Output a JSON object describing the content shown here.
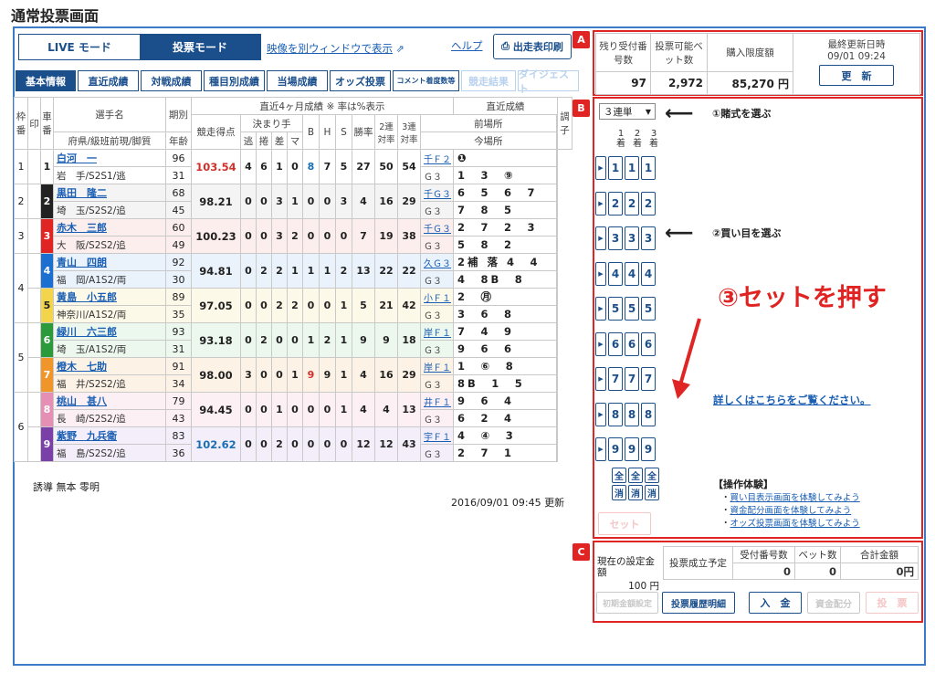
{
  "page_title": "通常投票画面",
  "mode": {
    "live": "LIVE モード",
    "vote": "投票モード"
  },
  "top_links": {
    "video": "映像を別ウィンドウで表示",
    "help": "ヘルプ",
    "print": "出走表印刷"
  },
  "tabs": [
    {
      "label": "基本情報",
      "state": "active"
    },
    {
      "label": "直近成績",
      "state": "normal"
    },
    {
      "label": "対戦成績",
      "state": "normal"
    },
    {
      "label": "種目別成績",
      "state": "normal"
    },
    {
      "label": "当場成績",
      "state": "normal"
    },
    {
      "label": "オッズ投票",
      "state": "normal"
    },
    {
      "label": "コメント着度数等",
      "state": "normal"
    },
    {
      "label": "競走結果",
      "state": "disabled"
    },
    {
      "label": "ダイジェスト",
      "state": "disabled"
    }
  ],
  "table_header": {
    "waku": "枠番",
    "shirushi": "印",
    "sha": "車番",
    "name": "選手名",
    "pref": "府県/級班前現/脚質",
    "kibetsu": "期別",
    "age": "年齢",
    "recent": "直近4ヶ月成績 ※ 率は%表示",
    "points": "競走得点",
    "kimarite": "決まり手",
    "k1": "逃",
    "k2": "捲",
    "k3": "差",
    "k4": "マ",
    "bb": "B",
    "hh": "H",
    "ss": "S",
    "win": "勝率",
    "ren2": "2連対率",
    "ren3": "3連対率",
    "results": "直近成績",
    "zen": "前場所",
    "kon": "今場所",
    "cho": "調子"
  },
  "riders": [
    {
      "waku": "1",
      "sha": "1",
      "name": "白河　一",
      "pref": "岩　手/S2S1/逃",
      "ki": "96",
      "age": "31",
      "pt": "103.54",
      "k": [
        "4",
        "6",
        "1",
        "0"
      ],
      "b": "8",
      "h": "7",
      "s": "5",
      "win": "27",
      "r2": "50",
      "r3": "54",
      "zen": "千Ｆ２",
      "zenr": "❶",
      "kon": "Ｇ３",
      "konr": "1　3　⑨",
      "color": "#ffffff",
      "tcolor": "#222",
      "bg": "#ffffff"
    },
    {
      "waku": "2",
      "sha": "2",
      "name": "黒田　隆二",
      "pref": "埼　玉/S2S2/追",
      "ki": "68",
      "age": "45",
      "pt": "98.21",
      "k": [
        "0",
        "0",
        "3",
        "1"
      ],
      "b": "0",
      "h": "0",
      "s": "3",
      "win": "4",
      "r2": "16",
      "r3": "29",
      "zen": "千Ｇ３",
      "zenr": "6　5　6　7",
      "kon": "Ｇ３",
      "konr": "7　8　5",
      "color": "#222",
      "tcolor": "#fff",
      "bg": "#f4f4f4"
    },
    {
      "waku": "3",
      "sha": "3",
      "name": "赤木　三郎",
      "pref": "大　阪/S2S2/追",
      "ki": "60",
      "age": "49",
      "pt": "100.23",
      "k": [
        "0",
        "0",
        "3",
        "2"
      ],
      "b": "0",
      "h": "0",
      "s": "0",
      "win": "7",
      "r2": "19",
      "r3": "38",
      "zen": "千Ｇ３",
      "zenr": "2　7　2　3",
      "kon": "Ｇ３",
      "konr": "5　8　2",
      "color": "#e02424",
      "tcolor": "#fff",
      "bg": "#fdeeee"
    },
    {
      "waku": "4",
      "sha": "4",
      "name": "青山　四朗",
      "pref": "福　岡/A1S2/両",
      "ki": "92",
      "age": "30",
      "pt": "94.81",
      "k": [
        "0",
        "2",
        "2",
        "1"
      ],
      "b": "1",
      "h": "1",
      "s": "2",
      "win": "13",
      "r2": "22",
      "r3": "22",
      "zen": "久Ｇ３",
      "zenr": "2補 落 4　4",
      "kon": "Ｇ３",
      "konr": "4　8B　8",
      "color": "#1a6fd0",
      "tcolor": "#fff",
      "bg": "#eaf2fc"
    },
    {
      "waku": "4",
      "sha": "5",
      "name": "黄島　小五郎",
      "pref": "神奈川/A1S2/両",
      "ki": "89",
      "age": "35",
      "pt": "97.05",
      "k": [
        "0",
        "0",
        "2",
        "2"
      ],
      "b": "0",
      "h": "0",
      "s": "1",
      "win": "5",
      "r2": "21",
      "r3": "42",
      "zen": "小Ｆ１",
      "zenr": "2　㊊",
      "kon": "Ｇ３",
      "konr": "3　6　8",
      "color": "#f2d54a",
      "tcolor": "#222",
      "bg": "#fdf9e8"
    },
    {
      "waku": "5",
      "sha": "6",
      "name": "緑川　六三郎",
      "pref": "埼　玉/A1S2/両",
      "ki": "93",
      "age": "31",
      "pt": "93.18",
      "k": [
        "0",
        "2",
        "0",
        "0"
      ],
      "b": "1",
      "h": "2",
      "s": "1",
      "win": "9",
      "r2": "9",
      "r3": "18",
      "zen": "岸Ｆ１",
      "zenr": "7　4　9",
      "kon": "Ｇ３",
      "konr": "9　6　6",
      "color": "#2a9a3a",
      "tcolor": "#fff",
      "bg": "#ecf7ee"
    },
    {
      "waku": "5",
      "sha": "7",
      "name": "橙木　七助",
      "pref": "福　井/S2S2/追",
      "ki": "91",
      "age": "34",
      "pt": "98.00",
      "k": [
        "3",
        "0",
        "0",
        "1"
      ],
      "b": "9",
      "h": "9",
      "s": "1",
      "win": "4",
      "r2": "16",
      "r3": "29",
      "zen": "岸Ｆ１",
      "zenr": "1　⑥　8",
      "kon": "Ｇ３",
      "konr": "8B　1　5",
      "color": "#f0952a",
      "tcolor": "#fff",
      "bg": "#fdf2e6"
    },
    {
      "waku": "6",
      "sha": "8",
      "name": "桃山　甚八",
      "pref": "長　崎/S2S2/追",
      "ki": "79",
      "age": "43",
      "pt": "94.45",
      "k": [
        "0",
        "0",
        "1",
        "0"
      ],
      "b": "0",
      "h": "0",
      "s": "1",
      "win": "4",
      "r2": "4",
      "r3": "13",
      "zen": "井Ｆ１",
      "zenr": "9　6　4",
      "kon": "Ｇ３",
      "konr": "6　2　4",
      "color": "#e58fb5",
      "tcolor": "#fff",
      "bg": "#fcf0f5"
    },
    {
      "waku": "6",
      "sha": "9",
      "name": "紫野　九兵衛",
      "pref": "福　島/S2S2/追",
      "ki": "83",
      "age": "36",
      "pt": "102.62",
      "k": [
        "0",
        "0",
        "2",
        "0"
      ],
      "b": "0",
      "h": "0",
      "s": "0",
      "win": "12",
      "r2": "12",
      "r3": "43",
      "zen": "宇Ｆ１",
      "zenr": "4　④　3",
      "kon": "Ｇ３",
      "konr": "2　7　1",
      "color": "#7b3fa8",
      "tcolor": "#fff",
      "bg": "#f3eefa"
    }
  ],
  "footer_note": "誘導 無本 零明",
  "updated_at": "2016/09/01 09:45 更新",
  "panel_a": {
    "label": "A",
    "h1": "残り受付番号数",
    "h2": "投票可能ベット数",
    "h3": "購入限度額",
    "h4": "最終更新日時",
    "v1": "97",
    "v2": "2,972",
    "v3": "85,270 円",
    "v4": "09/01 09:24",
    "update_btn": "更　新"
  },
  "panel_b": {
    "label": "B",
    "bet_type": "３連単",
    "col1": "1着",
    "col2": "2着",
    "col3": "3着",
    "step1": "①賭式を選ぶ",
    "step2": "②買い目を選ぶ",
    "step3": "③セットを押す",
    "detail_link": "詳しくはこちらをご覧ください。",
    "all": "全",
    "clear": "消",
    "set_btn": "セット",
    "exp_title": "【操作体験】",
    "exp_links": [
      "買い目表示画面を体験してみよう",
      "資金配分画面を体験してみよう",
      "オッズ投票画面を体験してみよう"
    ],
    "nums": [
      "1",
      "2",
      "3",
      "4",
      "5",
      "6",
      "7",
      "8",
      "9"
    ]
  },
  "panel_c": {
    "label": "C",
    "current_amount_label": "現在の設定金額",
    "current_amount": "100 円",
    "h1": "投票成立予定",
    "h2": "受付番号数",
    "h3": "ベット数",
    "h4": "合計金額",
    "v2": "0",
    "v3": "0",
    "v4": "0円",
    "btn_init": "初期金額設定",
    "btn_history": "投票履歴明細",
    "btn_deposit": "入　金",
    "btn_alloc": "資金配分",
    "btn_vote": "投　票"
  },
  "colors": {
    "accent": "#1b4f8c",
    "highlight": "#e02424",
    "link": "#1a5fb4"
  }
}
